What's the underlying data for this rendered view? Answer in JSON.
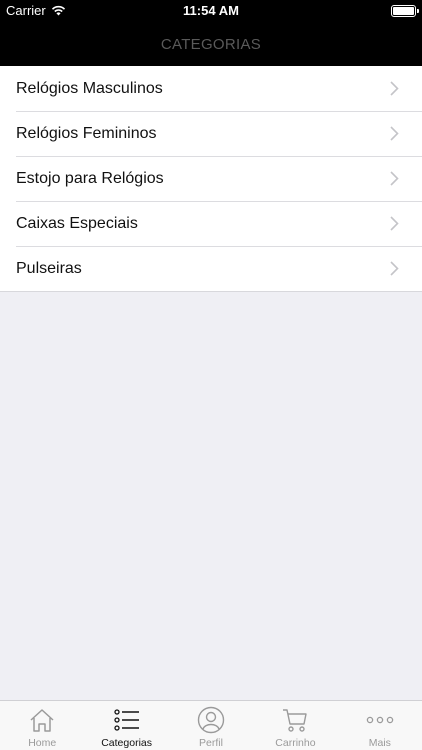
{
  "status_bar": {
    "carrier": "Carrier",
    "time": "11:54 AM"
  },
  "header": {
    "title": "CATEGORIAS"
  },
  "categories": [
    {
      "label": "Relógios Masculinos"
    },
    {
      "label": "Relógios Femininos"
    },
    {
      "label": "Estojo para Relógios"
    },
    {
      "label": "Caixas Especiais"
    },
    {
      "label": "Pulseiras"
    }
  ],
  "tabs": [
    {
      "label": "Home",
      "icon": "home-icon"
    },
    {
      "label": "Categorias",
      "icon": "list-icon",
      "active": true
    },
    {
      "label": "Perfil",
      "icon": "profile-icon"
    },
    {
      "label": "Carrinho",
      "icon": "cart-icon"
    },
    {
      "label": "Mais",
      "icon": "more-icon"
    }
  ],
  "colors": {
    "nav_background": "#000000",
    "page_background": "#efeff4",
    "active_tab": "#111111",
    "inactive_tab": "#9a9a9a"
  }
}
